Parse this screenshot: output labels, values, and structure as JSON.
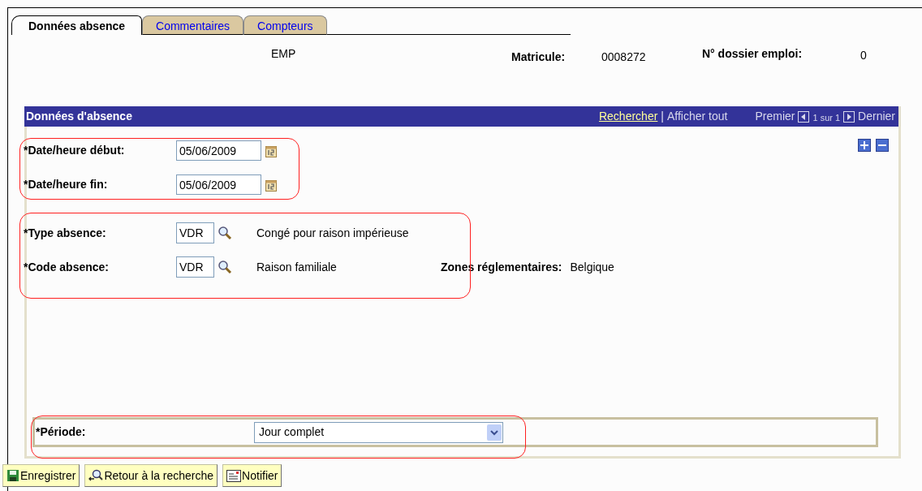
{
  "tabs": [
    {
      "label": "Données absence",
      "selected": true
    },
    {
      "label": "Commentaires",
      "selected": false
    },
    {
      "label": "Compteurs",
      "selected": false
    }
  ],
  "header": {
    "employee": "EMP",
    "matricule_label": "Matricule:",
    "matricule": "0008272",
    "dossier_label": "N° dossier emploi:",
    "dossier": "0"
  },
  "panel": {
    "title": "Données d'absence",
    "search_link": "Rechercher",
    "separator": "|",
    "show_all": "Afficher tout",
    "first": "Premier",
    "position": "1 sur 1",
    "last": "Dernier"
  },
  "dates": [
    {
      "label": "*Date/heure début:",
      "value": "05/06/2009"
    },
    {
      "label": "*Date/heure fin:",
      "value": "05/06/2009"
    }
  ],
  "absence": [
    {
      "label": "*Type absence:",
      "value": "VDR",
      "description": "Congé pour raison impérieuse"
    },
    {
      "label": "*Code absence:",
      "value": "VDR",
      "description": "Raison familiale"
    }
  ],
  "zones": {
    "label": "Zones réglementaires:",
    "value": "Belgique"
  },
  "periode": {
    "label": "*Période:",
    "value": "Jour complet"
  },
  "buttons": [
    {
      "label": "Enregistrer",
      "kind": "save"
    },
    {
      "label": "Retour à la recherche",
      "kind": "search"
    },
    {
      "label": "Notifier",
      "kind": "notify"
    }
  ]
}
